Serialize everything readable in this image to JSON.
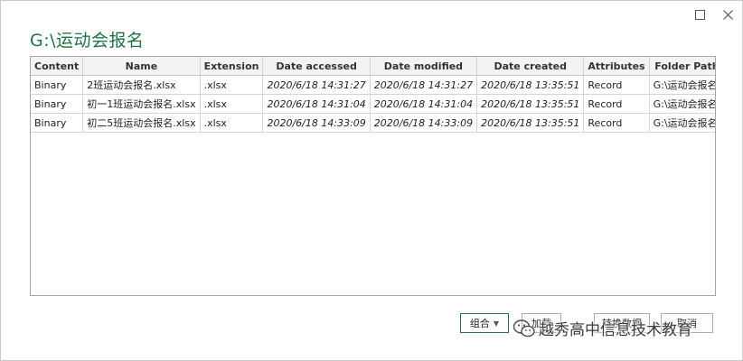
{
  "window": {
    "title": "G:\\运动会报名"
  },
  "table": {
    "columns": [
      "Content",
      "Name",
      "Extension",
      "Date accessed",
      "Date modified",
      "Date created",
      "Attributes",
      "Folder Path"
    ],
    "rows": [
      [
        "Binary",
        "2班运动会报名.xlsx",
        ".xlsx",
        "2020/6/18 14:31:27",
        "2020/6/18 14:31:27",
        "2020/6/18 13:35:51",
        "Record",
        "G:\\运动会报名\\"
      ],
      [
        "Binary",
        "初一1班运动会报名.xlsx",
        ".xlsx",
        "2020/6/18 14:31:04",
        "2020/6/18 14:31:04",
        "2020/6/18 13:35:51",
        "Record",
        "G:\\运动会报名\\"
      ],
      [
        "Binary",
        "初二5班运动会报名.xlsx",
        ".xlsx",
        "2020/6/18 14:33:09",
        "2020/6/18 14:33:09",
        "2020/6/18 13:35:51",
        "Record",
        "G:\\运动会报名\\"
      ]
    ]
  },
  "footer": {
    "combine_label": "组合",
    "load_label": "加载",
    "transform_label": "转换数据",
    "cancel_label": "取消"
  },
  "watermark": {
    "text": "越秀高中信息技术教育"
  },
  "colors": {
    "accent": "#217346"
  }
}
